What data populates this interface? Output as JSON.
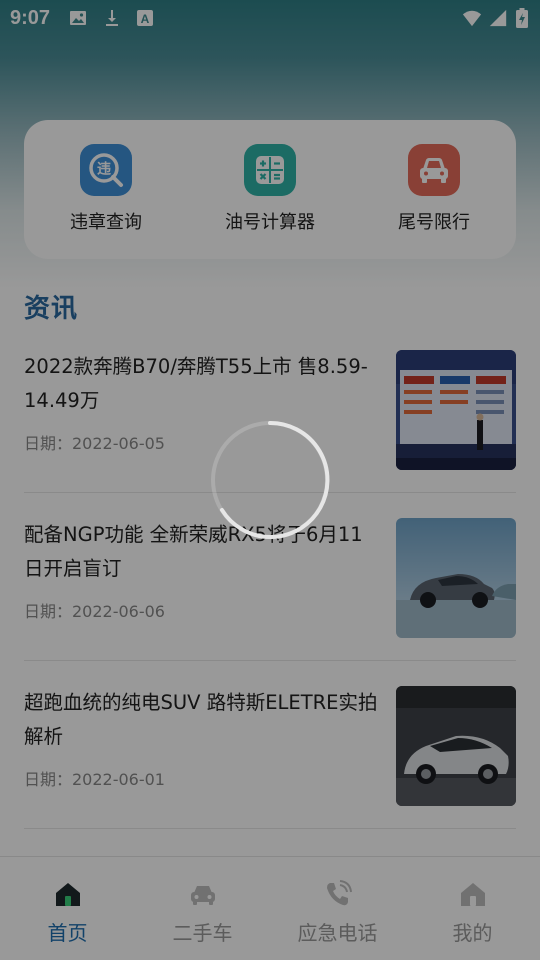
{
  "status_bar": {
    "time": "9:07",
    "left_icons": [
      "image-icon",
      "download-icon",
      "keyboard-a-icon"
    ],
    "right_icons": [
      "wifi-icon",
      "signal-icon",
      "battery-charging-icon"
    ]
  },
  "tools": [
    {
      "label": "违章查询",
      "icon": "violation-search-icon",
      "glyph": "违",
      "color": "#3f8fd8"
    },
    {
      "label": "油号计算器",
      "icon": "calculator-icon",
      "color": "#2fb3a7"
    },
    {
      "label": "尾号限行",
      "icon": "car-restriction-icon",
      "color": "#e56b5a"
    }
  ],
  "section": {
    "title": "资讯"
  },
  "news": [
    {
      "title": "2022款奔腾B70/奔腾T55上市 售8.59-14.49万",
      "date": "日期：2022-06-05"
    },
    {
      "title": "配备NGP功能 全新荣威RX5将于6月11日开启盲订",
      "date": "日期：2022-06-06"
    },
    {
      "title": "超跑血统的纯电SUV 路特斯ELETRE实拍解析",
      "date": "日期：2022-06-01"
    }
  ],
  "bottom_nav": [
    {
      "label": "首页",
      "icon": "home-icon",
      "active": true
    },
    {
      "label": "二手车",
      "icon": "used-car-icon",
      "active": false
    },
    {
      "label": "应急电话",
      "icon": "phone-icon",
      "active": false
    },
    {
      "label": "我的",
      "icon": "profile-icon",
      "active": false
    }
  ],
  "colors": {
    "accent": "#1f6fb0",
    "header_teal": "#2f7f86",
    "overlay": "rgba(0,0,0,0.40)"
  }
}
